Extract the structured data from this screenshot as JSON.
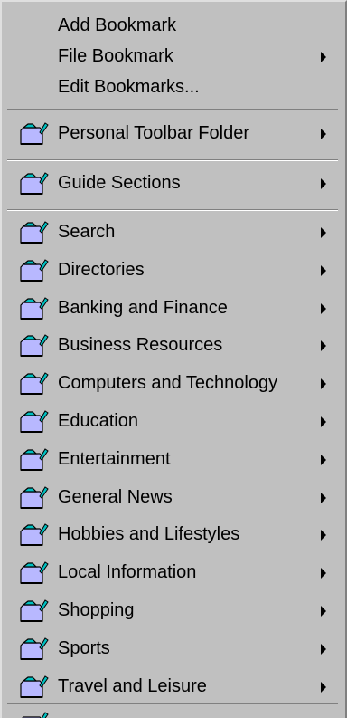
{
  "menu": {
    "top_items": [
      {
        "label": "Add Bookmark"
      },
      {
        "label": "File Bookmark",
        "submenu": true
      },
      {
        "label": "Edit Bookmarks..."
      }
    ],
    "personal_toolbar": {
      "label": "Personal Toolbar Folder",
      "icon": "folder-icon",
      "submenu": true
    },
    "guide_sections": {
      "label": "Guide Sections",
      "icon": "folder-icon",
      "submenu": true
    },
    "folders": [
      {
        "label": "Search",
        "icon": "folder-icon",
        "submenu": true
      },
      {
        "label": "Directories",
        "icon": "folder-icon",
        "submenu": true
      },
      {
        "label": "Banking and Finance",
        "icon": "folder-icon",
        "submenu": true
      },
      {
        "label": "Business Resources",
        "icon": "folder-icon",
        "submenu": true
      },
      {
        "label": "Computers and Technology",
        "icon": "folder-icon",
        "submenu": true
      },
      {
        "label": "Education",
        "icon": "folder-icon",
        "submenu": true
      },
      {
        "label": "Entertainment",
        "icon": "folder-icon",
        "submenu": true
      },
      {
        "label": "General News",
        "icon": "folder-icon",
        "submenu": true
      },
      {
        "label": "Hobbies and Lifestyles",
        "icon": "folder-icon",
        "submenu": true
      },
      {
        "label": "Local Information",
        "icon": "folder-icon",
        "submenu": true
      },
      {
        "label": "Shopping",
        "icon": "folder-icon",
        "submenu": true
      },
      {
        "label": "Sports",
        "icon": "folder-icon",
        "submenu": true
      },
      {
        "label": "Travel and Leisure",
        "icon": "folder-icon",
        "submenu": true
      }
    ]
  },
  "colors": {
    "menu_bg": "#c0c0c0",
    "folder_fill": "#b8b8ff",
    "folder_tab": "#00c0c0",
    "separator_dark": "#808080",
    "separator_light": "#ffffff"
  }
}
